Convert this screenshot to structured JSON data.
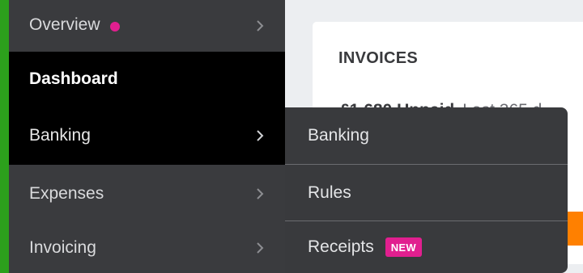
{
  "colors": {
    "nav_background": "#3a3b3e",
    "nav_accent": "#2ca01c",
    "nav_selected": "#000000",
    "notification_dot": "#e11f8f",
    "badge": "#e11f8f",
    "orange_button": "#ff8000",
    "flyout_background": "#393a3d"
  },
  "nav": {
    "items": [
      {
        "label": "Overview",
        "has_dot": true,
        "icon": "chevron-right-icon"
      },
      {
        "label": "Dashboard",
        "selected": true
      },
      {
        "label": "Banking",
        "hovered": true,
        "icon": "chevron-right-icon"
      },
      {
        "label": "Expenses",
        "icon": "chevron-right-icon"
      },
      {
        "label": "Invoicing",
        "icon": "chevron-right-icon"
      }
    ]
  },
  "invoices_card": {
    "title": "INVOICES",
    "amount": "£1,680 Unpaid",
    "period": "Last 365 d"
  },
  "flyout": {
    "items": [
      {
        "label": "Banking"
      },
      {
        "label": "Rules"
      },
      {
        "label": "Receipts",
        "badge": "NEW"
      }
    ]
  }
}
